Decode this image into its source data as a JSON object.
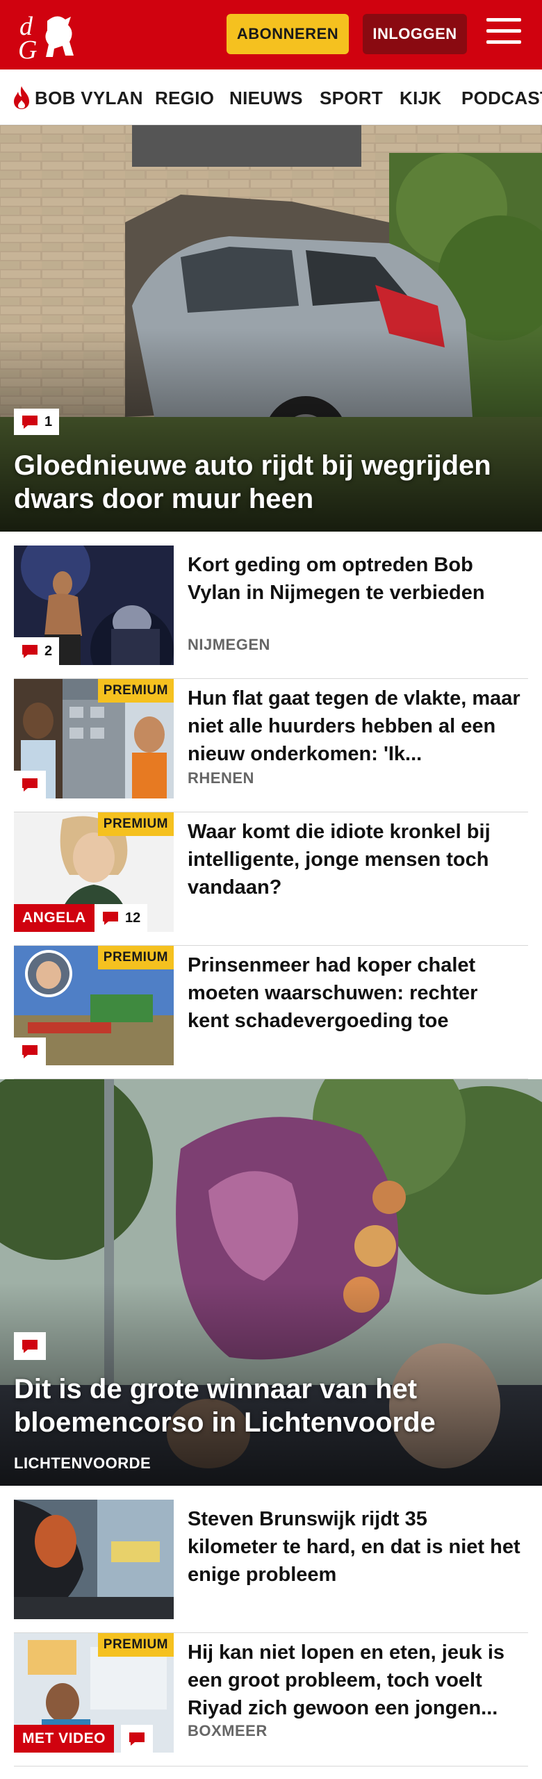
{
  "header": {
    "logo_text": "dG",
    "subscribe_label": "ABONNEREN",
    "login_label": "INLOGGEN"
  },
  "nav": {
    "items": [
      "BOB VYLAN",
      "REGIO",
      "NIEUWS",
      "SPORT",
      "KIJK",
      "PODCAST"
    ]
  },
  "hero1": {
    "title": "Gloednieuwe auto rijdt bij wegrijden dwars door muur heen",
    "comment_count": "1"
  },
  "articles": [
    {
      "title": "Kort geding om optreden Bob Vylan in Nijmegen te verbieden",
      "location": "NIJMEGEN",
      "comment_count": "2"
    },
    {
      "title": "Hun flat gaat tegen de vlakte, maar niet alle huurders hebben al een nieuw onderkomen: 'Ik...",
      "location": "RHENEN",
      "premium": "PREMIUM"
    },
    {
      "title": "Waar komt die idiote kronkel bij intelligente, jonge mensen toch vandaan?",
      "premium": "PREMIUM",
      "tag": "ANGELA",
      "comment_count": "12"
    },
    {
      "title": "Prinsenmeer had koper chalet moeten waarschuwen: rechter kent schadevergoeding toe",
      "premium": "PREMIUM"
    }
  ],
  "hero2": {
    "title": "Dit is de grote winnaar van het bloemencorso in Lichtenvoorde",
    "location": "LICHTENVOORDE"
  },
  "articles2": [
    {
      "title": "Steven Brunswijk rijdt 35 kilometer te hard, en dat is niet het enige probleem"
    },
    {
      "title": "Hij kan niet lopen en eten, jeuk is een groot probleem, toch voelt Riyad zich gewoon een jongen...",
      "location": "BOXMEER",
      "premium": "PREMIUM",
      "tag": "MET VIDEO"
    }
  ],
  "colors": {
    "brand_red": "#d0020f",
    "premium_yellow": "#f5c11f",
    "dark_red": "#8a0a11"
  },
  "icons": [
    "flame-icon",
    "comment-icon",
    "menu-icon"
  ]
}
